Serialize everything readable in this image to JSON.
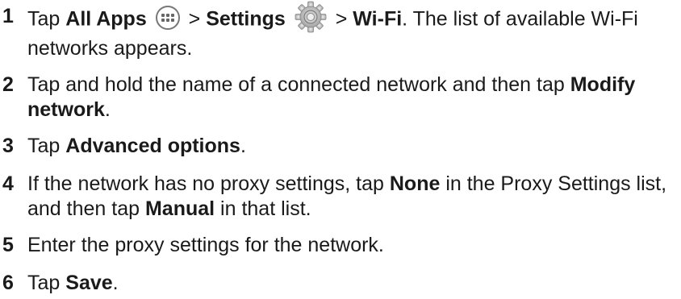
{
  "steps": [
    {
      "number": "1",
      "tap_word": "Tap",
      "all_apps": "All Apps",
      "sep1": ">",
      "settings": "Settings",
      "sep2": ">",
      "wifi": "Wi-Fi",
      "tail": ". The list of available Wi-Fi networks appears.",
      "icons": [
        "all-apps-icon",
        "settings-gear-icon"
      ]
    },
    {
      "number": "2",
      "text": "Tap and hold the name of a connected network and then tap",
      "bold": "Modify network",
      "end": "."
    },
    {
      "number": "3",
      "text": "Tap",
      "bold": "Advanced options",
      "end": "."
    },
    {
      "number": "4",
      "text_a": "If the network has no proxy settings, tap",
      "bold_a": "None",
      "text_b": "in the Proxy Settings list, and then tap",
      "bold_b": "Manual",
      "text_c": "in that list."
    },
    {
      "number": "5",
      "text": "Enter the proxy settings for the network."
    },
    {
      "number": "6",
      "text": "Tap",
      "bold": "Save",
      "end": "."
    }
  ]
}
